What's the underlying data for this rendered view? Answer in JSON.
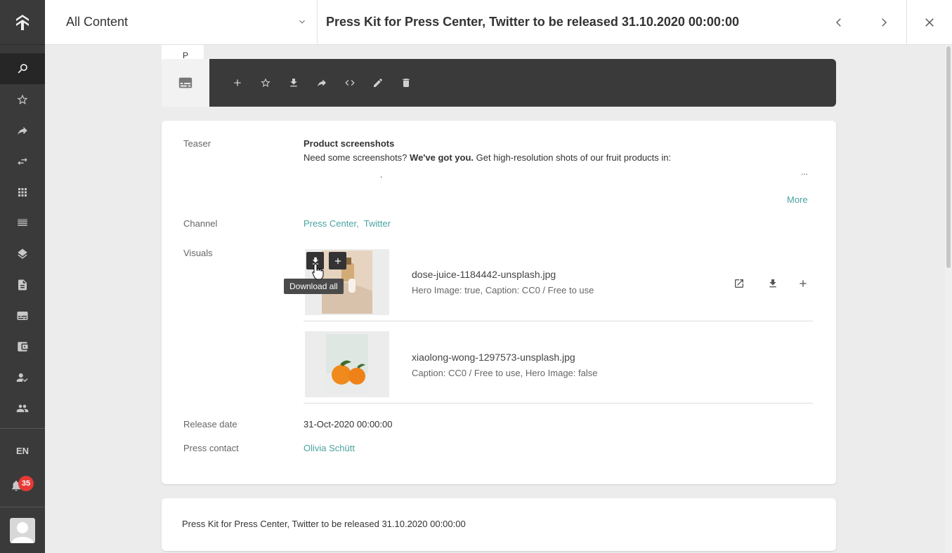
{
  "sidebar": {
    "items": [
      {
        "icon": "search-icon",
        "active": true
      },
      {
        "icon": "star-icon"
      },
      {
        "icon": "share-icon"
      },
      {
        "icon": "swap-icon"
      },
      {
        "icon": "grid-icon"
      },
      {
        "icon": "list-icon"
      },
      {
        "icon": "layers-icon"
      },
      {
        "icon": "document-icon"
      },
      {
        "icon": "card-icon"
      },
      {
        "icon": "wallet-icon"
      },
      {
        "icon": "user-check-icon"
      },
      {
        "icon": "people-icon"
      }
    ],
    "language": "EN",
    "notification_count": "35"
  },
  "header": {
    "selector_value": "All Content",
    "title": "Press Kit for Press Center, Twitter to be released 31.10.2020 00:00:00"
  },
  "tab_stub": "P",
  "detail": {
    "teaser_label": "Teaser",
    "teaser_heading": "Product screenshots",
    "teaser_text_before": "Need some screenshots? ",
    "teaser_text_bold": "We've got you.",
    "teaser_text_after": " Get high-resolution shots of our fruit products in:",
    "teaser_dot": ".",
    "teaser_ellipsis": "...",
    "more_label": "More",
    "channel_label": "Channel",
    "channels": [
      "Press Center,",
      "Twitter"
    ],
    "visuals_label": "Visuals",
    "download_all_tooltip": "Download all",
    "visuals": [
      {
        "filename": "dose-juice-1184442-unsplash.jpg",
        "meta": "Hero Image: true, Caption: CC0 / Free to use"
      },
      {
        "filename": "xiaolong-wong-1297573-unsplash.jpg",
        "meta": "Caption: CC0 / Free to use, Hero Image: false"
      }
    ],
    "release_date_label": "Release date",
    "release_date_value": "31-Oct-2020 00:00:00",
    "press_contact_label": "Press contact",
    "press_contact_value": "Olivia Schütt"
  },
  "summary_text": "Press Kit for Press Center, Twitter to be released 31.10.2020 00:00:00",
  "colors": {
    "sidebar_bg": "#3a3a3a",
    "toolbar_bg": "#3a3a3a",
    "link": "#4aa3a0",
    "badge": "#e53935"
  }
}
